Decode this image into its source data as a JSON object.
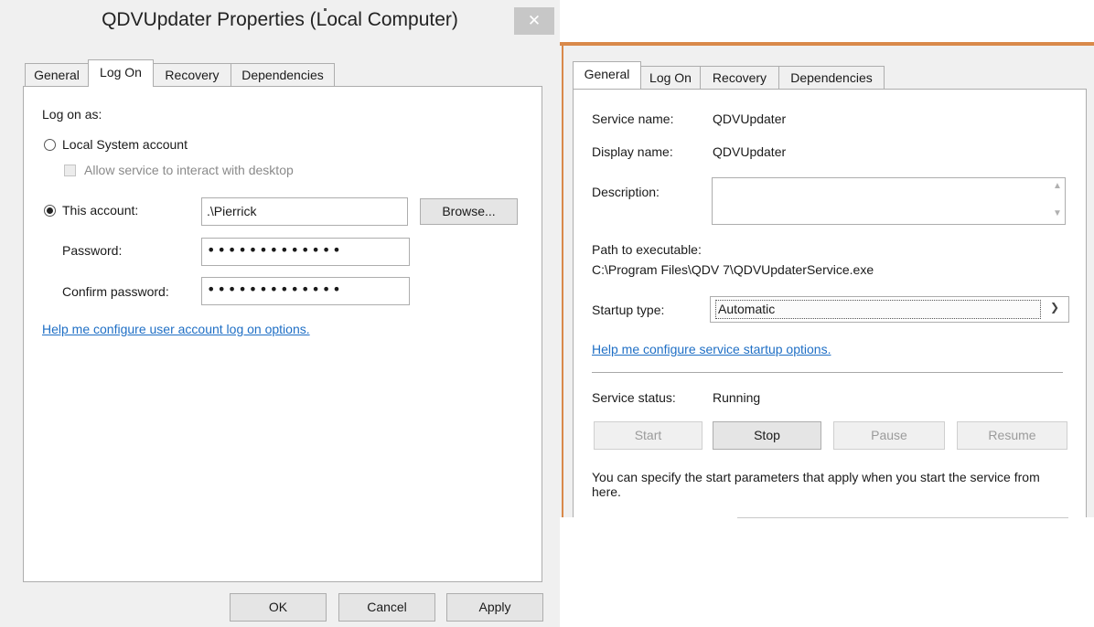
{
  "left_dialog": {
    "title": "QDVUpdater Properties (Local Computer)",
    "close_glyph": "✕",
    "tabs": [
      "General",
      "Log On",
      "Recovery",
      "Dependencies"
    ],
    "selected_tab": "Log On",
    "log_on_as": "Log on as:",
    "local_system": "Local System account",
    "allow_interact": "Allow service to interact with desktop",
    "this_account": "This account:",
    "account_value": ".\\Pierrick",
    "browse": "Browse...",
    "password_label": "Password:",
    "password_value": "•••••••••••••",
    "confirm_label": "Confirm password:",
    "confirm_value": "•••••••••••••",
    "help_link": "Help me configure user account log on options.",
    "buttons": {
      "ok": "OK",
      "cancel": "Cancel",
      "apply": "Apply"
    }
  },
  "right_dialog": {
    "tabs": [
      "General",
      "Log On",
      "Recovery",
      "Dependencies"
    ],
    "selected_tab": "General",
    "service_name_label": "Service name:",
    "service_name": "QDVUpdater",
    "display_name_label": "Display name:",
    "display_name": "QDVUpdater",
    "description_label": "Description:",
    "description": "",
    "path_label": "Path to executable:",
    "path": "C:\\Program Files\\QDV 7\\QDVUpdaterService.exe",
    "startup_type_label": "Startup type:",
    "startup_type": "Automatic",
    "help_link": "Help me configure service startup options.",
    "service_status_label": "Service status:",
    "service_status": "Running",
    "buttons": {
      "start": "Start",
      "stop": "Stop",
      "pause": "Pause",
      "resume": "Resume"
    },
    "note": "You can specify the start parameters that apply when you start the service from here."
  },
  "colors": {
    "accent": "#d9894a",
    "link": "#1f6fc5"
  }
}
